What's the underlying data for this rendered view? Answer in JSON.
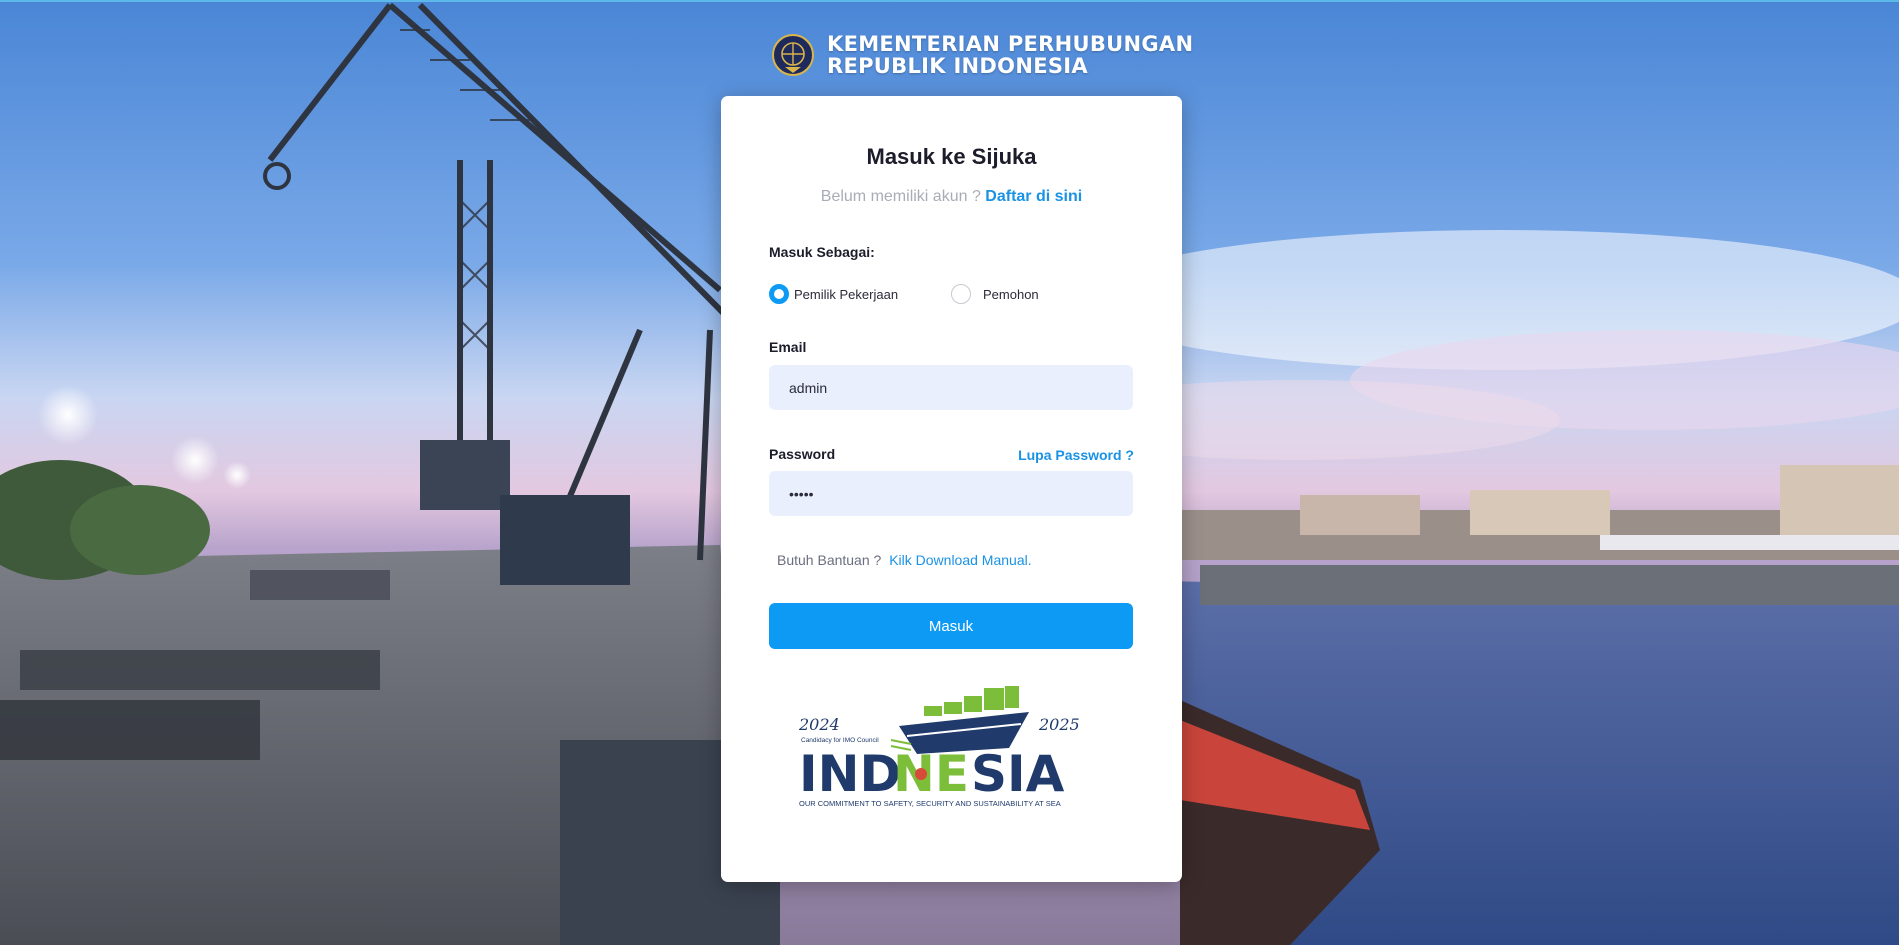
{
  "header": {
    "line1": "KEMENTERIAN PERHUBUNGAN",
    "line2": "REPUBLIK INDONESIA"
  },
  "login": {
    "title": "Masuk ke Sijuka",
    "no_account_text": "Belum memiliki akun ?",
    "register_link": "Daftar di sini",
    "role_label": "Masuk Sebagai:",
    "roles": [
      {
        "label": "Pemilik Pekerjaan",
        "selected": true
      },
      {
        "label": "Pemohon",
        "selected": false
      }
    ],
    "email_label": "Email",
    "email_value": "admin",
    "password_label": "Password",
    "password_value": "admin",
    "forgot_link": "Lupa Password ?",
    "help_text": "Butuh Bantuan ?",
    "help_link": "Kilk Download Manual.",
    "submit_label": "Masuk"
  },
  "campaign_logo": {
    "year_start": "2024",
    "year_end": "2025",
    "candidacy": "Candidacy for IMO Council",
    "word_a": "IND",
    "word_b": "NE",
    "word_c": "SIA",
    "tagline": "OUR COMMITMENT TO SAFETY, SECURITY AND SUSTAINABILITY AT SEA"
  },
  "colors": {
    "accent": "#0d9af5",
    "link": "#1a92e6",
    "input_bg": "#e9effd",
    "logo_navy": "#1f3a6b",
    "logo_green": "#7cbd3a"
  }
}
